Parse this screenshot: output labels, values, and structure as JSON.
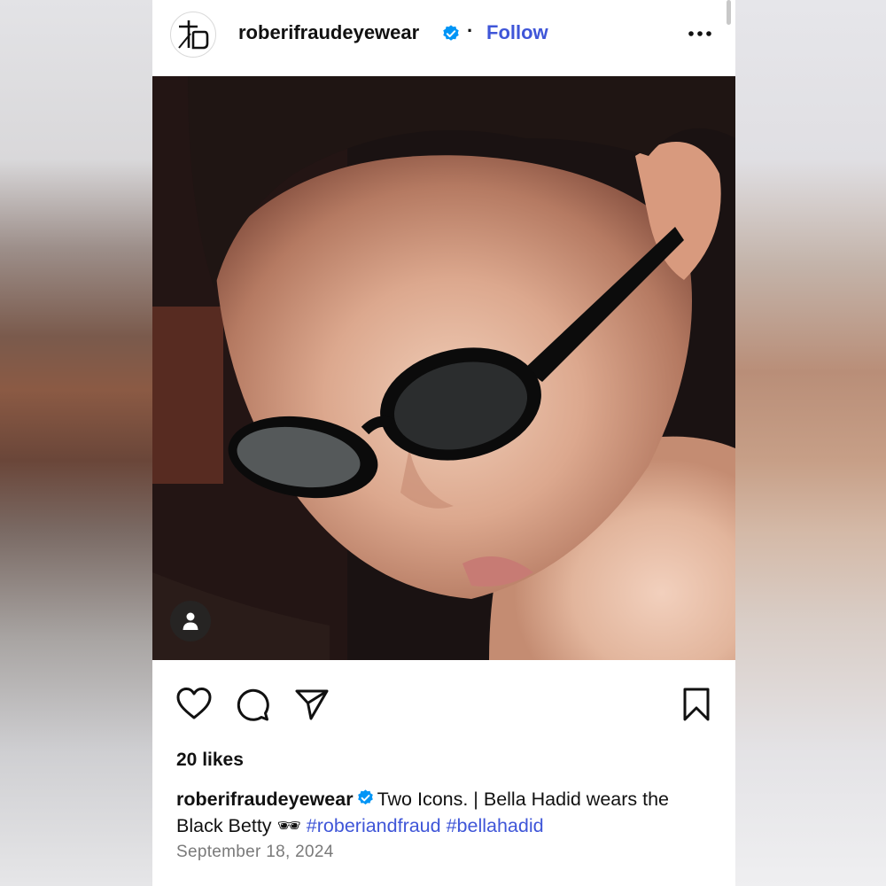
{
  "post": {
    "username": "roberifraudeyewear",
    "follow_label": "Follow",
    "dot": "·",
    "likes": "20 likes",
    "caption_user": "roberifraudeyewear",
    "caption_text": "Two Icons. | Bella Hadid wears the Black Betty 🕶",
    "hashtags": [
      "#roberiandfraud",
      "#bellahadid"
    ],
    "date": "September 18, 2024"
  },
  "colors": {
    "link": "#3f56d8",
    "verified": "#0095f6",
    "text": "#111111",
    "muted": "#7a7a7a"
  },
  "icons": [
    "brand-logo-icon",
    "verified-icon",
    "more-icon",
    "tagged-person-icon",
    "heart-icon",
    "comment-icon",
    "share-icon",
    "bookmark-icon"
  ]
}
